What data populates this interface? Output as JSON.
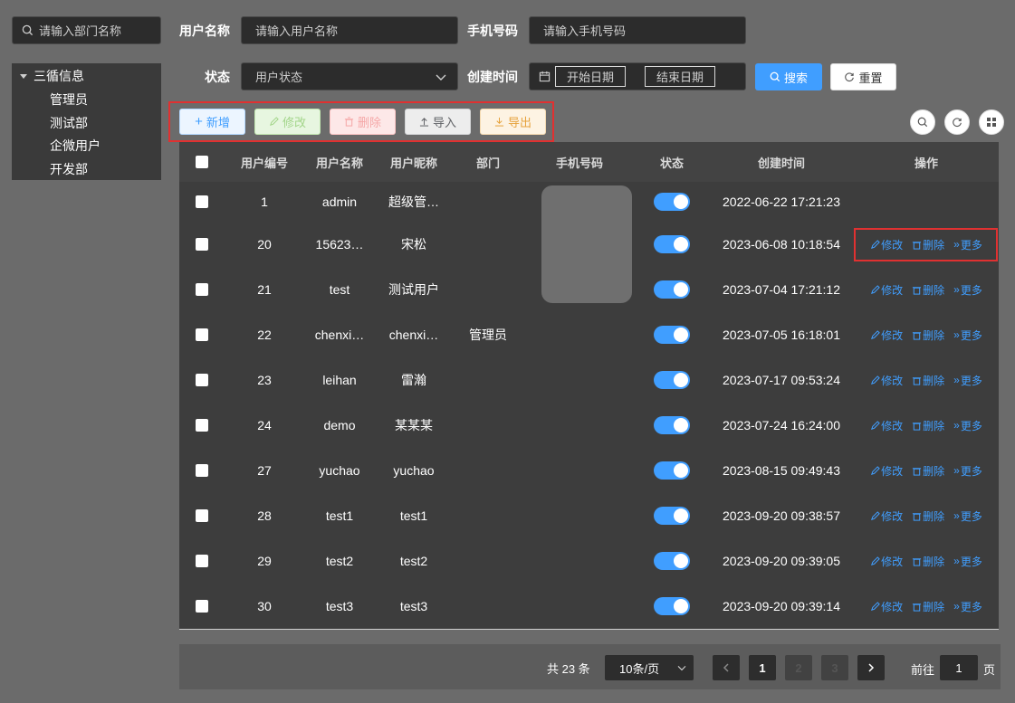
{
  "dept_search": {
    "placeholder": "请输入部门名称"
  },
  "tree": {
    "root": "三循信息",
    "children": [
      "管理员",
      "测试部",
      "企微用户",
      "开发部"
    ]
  },
  "filters": {
    "username_label": "用户名称",
    "username_placeholder": "请输入用户名称",
    "phone_label": "手机号码",
    "phone_placeholder": "请输入手机号码",
    "status_label": "状态",
    "status_placeholder": "用户状态",
    "created_label": "创建时间",
    "start_date": "开始日期",
    "end_date": "结束日期",
    "search_btn": "搜索",
    "reset_btn": "重置"
  },
  "toolbar": {
    "add": "新增",
    "edit": "修改",
    "delete": "删除",
    "import": "导入",
    "export": "导出"
  },
  "table": {
    "headers": [
      "用户编号",
      "用户名称",
      "用户昵称",
      "部门",
      "手机号码",
      "状态",
      "创建时间",
      "操作"
    ],
    "rows": [
      {
        "id": "1",
        "username": "admin",
        "nickname": "超级管…",
        "dept": "",
        "created": "2022-06-22 17:21:23",
        "ops": false
      },
      {
        "id": "20",
        "username": "15623…",
        "nickname": "宋松",
        "dept": "",
        "created": "2023-06-08 10:18:54",
        "ops": true
      },
      {
        "id": "21",
        "username": "test",
        "nickname": "测试用户",
        "dept": "",
        "created": "2023-07-04 17:21:12",
        "ops": true
      },
      {
        "id": "22",
        "username": "chenxi…",
        "nickname": "chenxi…",
        "dept": "管理员",
        "created": "2023-07-05 16:18:01",
        "ops": true
      },
      {
        "id": "23",
        "username": "leihan",
        "nickname": "雷瀚",
        "dept": "",
        "created": "2023-07-17 09:53:24",
        "ops": true
      },
      {
        "id": "24",
        "username": "demo",
        "nickname": "某某某",
        "dept": "",
        "created": "2023-07-24 16:24:00",
        "ops": true
      },
      {
        "id": "27",
        "username": "yuchao",
        "nickname": "yuchao",
        "dept": "",
        "created": "2023-08-15 09:49:43",
        "ops": true
      },
      {
        "id": "28",
        "username": "test1",
        "nickname": "test1",
        "dept": "",
        "created": "2023-09-20 09:38:57",
        "ops": true
      },
      {
        "id": "29",
        "username": "test2",
        "nickname": "test2",
        "dept": "",
        "created": "2023-09-20 09:39:05",
        "ops": true
      },
      {
        "id": "30",
        "username": "test3",
        "nickname": "test3",
        "dept": "",
        "created": "2023-09-20 09:39:14",
        "ops": true
      }
    ],
    "op_edit": "修改",
    "op_delete": "删除",
    "op_more": "更多"
  },
  "pagination": {
    "total_text": "共 23 条",
    "page_size": "10条/页",
    "pages": [
      "1",
      "2",
      "3"
    ],
    "current_page": "1",
    "goto_prefix": "前往",
    "goto_value": "1",
    "goto_suffix": "页"
  },
  "colors": {
    "primary": "#409eff",
    "highlight_border": "#e03131",
    "page_bg": "#6b6b6b",
    "table_bg": "#3d3d3d"
  }
}
